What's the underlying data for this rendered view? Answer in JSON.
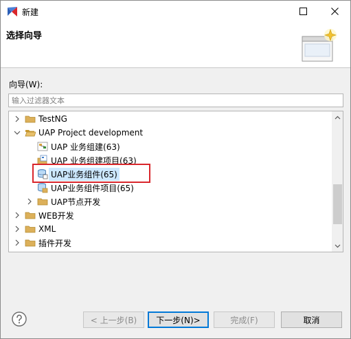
{
  "window": {
    "title": "新建",
    "banner_title": "选择向导"
  },
  "wizards_label": "向导(W):",
  "filter": {
    "placeholder": "输入过滤器文本",
    "value": ""
  },
  "tree": {
    "items": [
      {
        "label": "TestNG",
        "icon": "folder-icon",
        "expanded": false,
        "depth": 0
      },
      {
        "label": "UAP Project development",
        "icon": "folder-open-icon",
        "expanded": true,
        "depth": 0
      },
      {
        "label": "UAP 业务组建(63)",
        "icon": "component-icon",
        "depth": 1
      },
      {
        "label": "UAP 业务组建项目(63)",
        "icon": "component-project-icon",
        "depth": 1
      },
      {
        "label": "UAP业务组件(65)",
        "icon": "database-icon",
        "depth": 1,
        "selected": true
      },
      {
        "label": "UAP业务组件项目(65)",
        "icon": "database-project-icon",
        "depth": 1
      },
      {
        "label": "UAP节点开发",
        "icon": "folder-icon",
        "expanded": false,
        "depth": 1
      },
      {
        "label": "WEB开发",
        "icon": "folder-icon",
        "expanded": false,
        "depth": 0
      },
      {
        "label": "XML",
        "icon": "folder-icon",
        "expanded": false,
        "depth": 0
      },
      {
        "label": "插件开发",
        "icon": "folder-icon",
        "expanded": false,
        "depth": 0
      }
    ]
  },
  "buttons": {
    "back": "< 上一步(B)",
    "next": "下一步(N)>",
    "finish": "完成(F)",
    "cancel": "取消"
  },
  "colors": {
    "selection": "#cce8ff",
    "highlight_border": "#d9262b",
    "folder": "#dcb05a"
  }
}
